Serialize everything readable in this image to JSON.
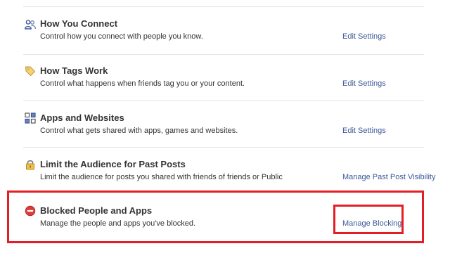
{
  "rows": [
    {
      "title": "How You Connect",
      "description": "Control how you connect with people you know.",
      "link": "Edit Settings",
      "icon": "people-icon"
    },
    {
      "title": "How Tags Work",
      "description": "Control what happens when friends tag you or your content.",
      "link": "Edit Settings",
      "icon": "tag-icon"
    },
    {
      "title": "Apps and Websites",
      "description": "Control what gets shared with apps, games and websites.",
      "link": "Edit Settings",
      "icon": "apps-grid-icon"
    },
    {
      "title": "Limit the Audience for Past Posts",
      "description": "Limit the audience for posts you shared with friends of friends or Public",
      "link": "Manage Past Post Visibility",
      "icon": "lock-icon"
    },
    {
      "title": "Blocked People and Apps",
      "description": "Manage the people and apps you've blocked.",
      "link": "Manage Blocking",
      "icon": "blocked-icon"
    }
  ],
  "colors": {
    "link": "#3b5998",
    "highlight": "#e41e26",
    "text": "#333333"
  }
}
